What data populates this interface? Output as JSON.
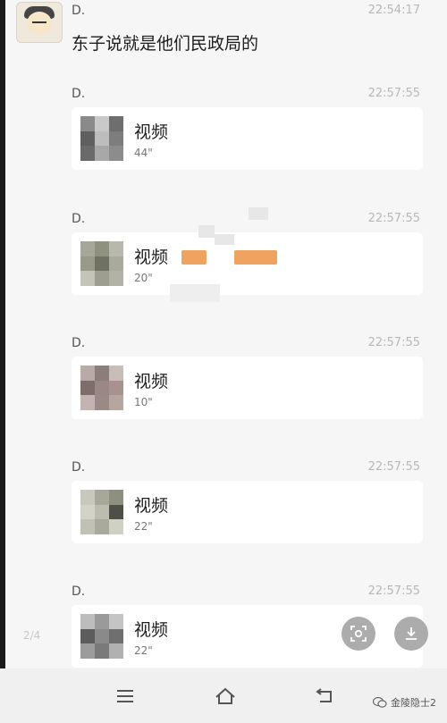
{
  "first_message": {
    "sender": "D.",
    "time": "22:54:17",
    "text": "东子说就是他们民政局的"
  },
  "video_messages": [
    {
      "sender": "D.",
      "time": "22:57:55",
      "title": "视频",
      "duration": "44\""
    },
    {
      "sender": "D.",
      "time": "22:57:55",
      "title": "视频",
      "duration": "20\""
    },
    {
      "sender": "D.",
      "time": "22:57:55",
      "title": "视频",
      "duration": "10\""
    },
    {
      "sender": "D.",
      "time": "22:57:55",
      "title": "视频",
      "duration": "22\""
    },
    {
      "sender": "D.",
      "time": "22:57:55",
      "title": "视频",
      "duration": "22\""
    }
  ],
  "page_indicator": "2/4",
  "watermark": "金陵隐士2",
  "icons": {
    "scan": "scan-icon",
    "download": "download-icon",
    "menu": "menu-icon",
    "home": "home-icon",
    "back": "back-icon"
  },
  "colors": {
    "background": "#f6f6f6",
    "bubble": "#ffffff",
    "redaction": "#f0a35e"
  }
}
